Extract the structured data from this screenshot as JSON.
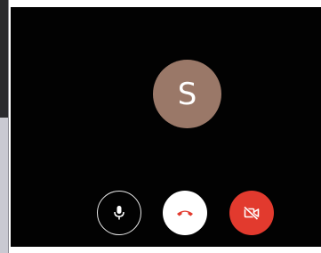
{
  "call": {
    "participant_initial": "S",
    "avatar_color": "#9a7868",
    "background_color": "#020202"
  },
  "controls": {
    "mic": {
      "icon": "mic-icon",
      "state": "on"
    },
    "end_call": {
      "icon": "phone-hangup-icon",
      "icon_color": "#e23a2e"
    },
    "camera": {
      "icon": "video-off-icon",
      "state": "off",
      "color": "#e23a2e"
    }
  }
}
